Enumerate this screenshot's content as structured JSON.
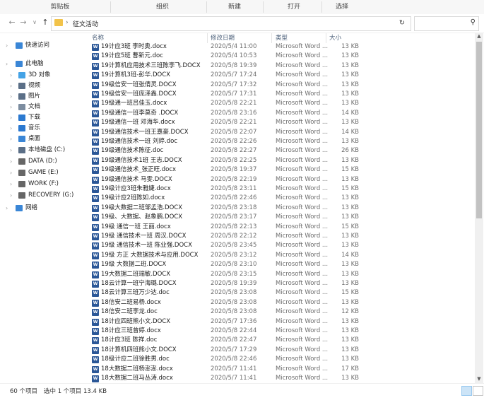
{
  "ribbon": {
    "clipboard": "剪贴板",
    "organize": "组织",
    "new": "新建",
    "open": "打开",
    "select": "选择"
  },
  "address": {
    "crumb": "征文活动",
    "search_placeholder": ""
  },
  "nav": [
    {
      "label": "快速访问",
      "icon": "star-icon",
      "indent": 0,
      "color": "#3a86d6"
    },
    {
      "label": "此电脑",
      "icon": "computer-icon",
      "indent": 0,
      "color": "#3a86d6"
    },
    {
      "label": "3D 对象",
      "icon": "cube-icon",
      "indent": 1,
      "color": "#45a3e6"
    },
    {
      "label": "视频",
      "icon": "video-icon",
      "indent": 1,
      "color": "#5b6f87"
    },
    {
      "label": "图片",
      "icon": "picture-icon",
      "indent": 1,
      "color": "#5b6f87"
    },
    {
      "label": "文档",
      "icon": "document-icon",
      "indent": 1,
      "color": "#7c8da0"
    },
    {
      "label": "下载",
      "icon": "download-icon",
      "indent": 1,
      "color": "#2b79d0"
    },
    {
      "label": "音乐",
      "icon": "music-icon",
      "indent": 1,
      "color": "#2b79d0"
    },
    {
      "label": "桌面",
      "icon": "desktop-icon",
      "indent": 1,
      "color": "#3a86d6"
    },
    {
      "label": "本地磁盘 (C:)",
      "icon": "drive-icon",
      "indent": 1,
      "color": "#5b6f87"
    },
    {
      "label": "DATA (D:)",
      "icon": "drive-icon",
      "indent": 1,
      "color": "#666"
    },
    {
      "label": "GAME (E:)",
      "icon": "drive-icon",
      "indent": 1,
      "color": "#666"
    },
    {
      "label": "WORK (F:)",
      "icon": "drive-icon",
      "indent": 1,
      "color": "#666"
    },
    {
      "label": "RECOVERY (G:)",
      "icon": "drive-icon",
      "indent": 1,
      "color": "#666"
    },
    {
      "label": "网络",
      "icon": "network-icon",
      "indent": 0,
      "color": "#3a86d6"
    }
  ],
  "columns": {
    "name": "名称",
    "date": "修改日期",
    "type": "类型",
    "size": "大小"
  },
  "files": [
    [
      "19计应3班 李时奥.docx",
      "2020/5/4 11:00",
      "Microsoft Word ...",
      "13 KB"
    ],
    [
      "19计应5班 曹新元.doc",
      "2020/5/4 10:53",
      "Microsoft Word ...",
      "13 KB"
    ],
    [
      "19计算机应用技术三班陈李飞.DOCX",
      "2020/5/8 19:39",
      "Microsoft Word ...",
      "13 KB"
    ],
    [
      "19计算机3班-彭华.DOCX",
      "2020/5/7 17:24",
      "Microsoft Word ...",
      "13 KB"
    ],
    [
      "19级信安一班张倩灵.DOCX",
      "2020/5/7 17:32",
      "Microsoft Word ...",
      "13 KB"
    ],
    [
      "19级信安一班庞泽鑫.DOCX",
      "2020/5/7 17:31",
      "Microsoft Word ...",
      "13 KB"
    ],
    [
      "19级通一班吕佳玉.docx",
      "2020/5/8 22:21",
      "Microsoft Word ...",
      "13 KB"
    ],
    [
      "19级通信一班李莫奇 .DOCX",
      "2020/5/8 23:16",
      "Microsoft Word ...",
      "14 KB"
    ],
    [
      "19级通信一班 邓海华.docx",
      "2020/5/8 22:21",
      "Microsoft Word ...",
      "13 KB"
    ],
    [
      "19级通信技术一班王嘉豪.DOCX",
      "2020/5/8 22:07",
      "Microsoft Word ...",
      "14 KB"
    ],
    [
      "19级通信技术一班 刘婷.doc",
      "2020/5/8 22:26",
      "Microsoft Word ...",
      "13 KB"
    ],
    [
      "19级通信技术陈征.doc",
      "2020/5/8 22:27",
      "Microsoft Word ...",
      "26 KB"
    ],
    [
      "19级通信技术1班 王志.DOCX",
      "2020/5/8 22:25",
      "Microsoft Word ...",
      "13 KB"
    ],
    [
      "19级通信技术_张正旺.docx",
      "2020/5/8 19:37",
      "Microsoft Word ...",
      "15 KB"
    ],
    [
      "19级通信技术 马雯.DOCX",
      "2020/5/8 22:19",
      "Microsoft Word ...",
      "13 KB"
    ],
    [
      "19级计应3班朱雅婕.docx",
      "2020/5/8 23:11",
      "Microsoft Word ...",
      "15 KB"
    ],
    [
      "19级计应2班陈如.docx",
      "2020/5/8 22:46",
      "Microsoft Word ...",
      "13 KB"
    ],
    [
      "19级大数据二班邹孟浩.DOCX",
      "2020/5/8 23:18",
      "Microsoft Word ...",
      "13 KB"
    ],
    [
      "19级、大数据、赵象鹏.DOCX",
      "2020/5/8 23:17",
      "Microsoft Word ...",
      "13 KB"
    ],
    [
      "19级 通信一班 王丽.docx",
      "2020/5/8 22:13",
      "Microsoft Word ...",
      "15 KB"
    ],
    [
      "19级 通信技术一班 周汉.DOCX",
      "2020/5/8 22:12",
      "Microsoft Word ...",
      "13 KB"
    ],
    [
      "19级 通信技术一班 陈业强.DOCX",
      "2020/5/8 23:45",
      "Microsoft Word ...",
      "13 KB"
    ],
    [
      "19级 方正 大数据技术与应用.DOCX",
      "2020/5/8 23:12",
      "Microsoft Word ...",
      "14 KB"
    ],
    [
      "19级 大数据二班.DOCX",
      "2020/5/8 23:10",
      "Microsoft Word ...",
      "13 KB"
    ],
    [
      "19大数据二班瑞敏.DOCX",
      "2020/5/8 23:15",
      "Microsoft Word ...",
      "13 KB"
    ],
    [
      "18云计算一班宁海璐.DOCX",
      "2020/5/8 19:39",
      "Microsoft Word ...",
      "13 KB"
    ],
    [
      "18云计算三班万少达.doc",
      "2020/5/8 23:08",
      "Microsoft Word ...",
      "15 KB"
    ],
    [
      "18信安二班易杨.docx",
      "2020/5/8 23:08",
      "Microsoft Word ...",
      "13 KB"
    ],
    [
      "18信安二班李龙.doc",
      "2020/5/8 23:08",
      "Microsoft Word ...",
      "12 KB"
    ],
    [
      "18计应四班熊小文.DOCX",
      "2020/5/7 17:36",
      "Microsoft Word ...",
      "13 KB"
    ],
    [
      "18计应三班曾婷.docx",
      "2020/5/8 22:44",
      "Microsoft Word ...",
      "13 KB"
    ],
    [
      "18计应3班 陈祥.doc",
      "2020/5/8 22:47",
      "Microsoft Word ...",
      "13 KB"
    ],
    [
      "18计算机四班熊小文.DOCX",
      "2020/5/7 17:29",
      "Microsoft Word ...",
      "13 KB"
    ],
    [
      "18级计应二班徐胜男.doc",
      "2020/5/8 22:46",
      "Microsoft Word ...",
      "13 KB"
    ],
    [
      "18大数据二班杨澎澎.docx",
      "2020/5/7 11:41",
      "Microsoft Word ...",
      "17 KB"
    ],
    [
      "18大数据二班马丛涛.docx",
      "2020/5/7 11:41",
      "Microsoft Word ...",
      "13 KB"
    ]
  ],
  "status": {
    "count": "60 个项目",
    "selected": "选中 1 个项目  13.4 KB"
  }
}
